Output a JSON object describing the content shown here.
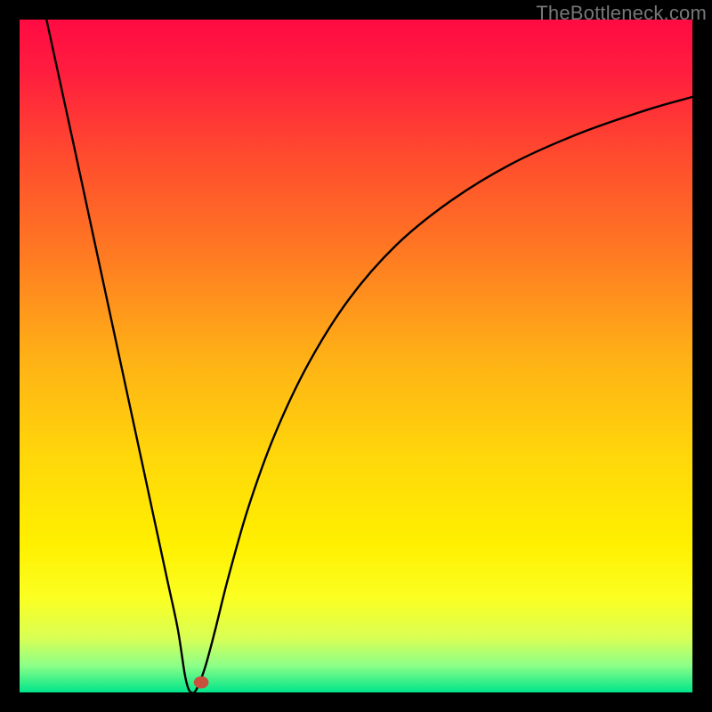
{
  "watermark": "TheBottleneck.com",
  "chart_data": {
    "type": "line",
    "title": "",
    "xlabel": "",
    "ylabel": "",
    "xlim": [
      0,
      100
    ],
    "ylim": [
      0,
      100
    ],
    "grid": false,
    "legend": false,
    "annotations": [],
    "gradient_stops": [
      {
        "offset": 0.0,
        "color": "#ff0b42"
      },
      {
        "offset": 0.08,
        "color": "#ff1e3e"
      },
      {
        "offset": 0.2,
        "color": "#ff4a2e"
      },
      {
        "offset": 0.35,
        "color": "#ff7a22"
      },
      {
        "offset": 0.5,
        "color": "#ffb016"
      },
      {
        "offset": 0.65,
        "color": "#ffd70a"
      },
      {
        "offset": 0.78,
        "color": "#fff000"
      },
      {
        "offset": 0.86,
        "color": "#fbff22"
      },
      {
        "offset": 0.92,
        "color": "#d8ff55"
      },
      {
        "offset": 0.96,
        "color": "#8cff88"
      },
      {
        "offset": 1.0,
        "color": "#00e58a"
      }
    ],
    "curve": {
      "minimum_x": 25.5,
      "minimum_y": 0,
      "points": [
        {
          "x": 4.0,
          "y": 100.0
        },
        {
          "x": 6.0,
          "y": 90.8
        },
        {
          "x": 8.0,
          "y": 81.6
        },
        {
          "x": 10.0,
          "y": 72.3
        },
        {
          "x": 12.0,
          "y": 63.0
        },
        {
          "x": 14.0,
          "y": 53.7
        },
        {
          "x": 16.0,
          "y": 44.4
        },
        {
          "x": 18.0,
          "y": 35.1
        },
        {
          "x": 20.0,
          "y": 25.8
        },
        {
          "x": 22.0,
          "y": 16.5
        },
        {
          "x": 23.5,
          "y": 9.5
        },
        {
          "x": 24.5,
          "y": 3.0
        },
        {
          "x": 25.0,
          "y": 0.8
        },
        {
          "x": 25.5,
          "y": 0.0
        },
        {
          "x": 26.2,
          "y": 0.3
        },
        {
          "x": 27.5,
          "y": 3.5
        },
        {
          "x": 29.0,
          "y": 9.0
        },
        {
          "x": 31.0,
          "y": 17.0
        },
        {
          "x": 34.0,
          "y": 27.5
        },
        {
          "x": 38.0,
          "y": 38.5
        },
        {
          "x": 43.0,
          "y": 49.0
        },
        {
          "x": 49.0,
          "y": 58.5
        },
        {
          "x": 56.0,
          "y": 66.5
        },
        {
          "x": 64.0,
          "y": 73.0
        },
        {
          "x": 73.0,
          "y": 78.5
        },
        {
          "x": 83.0,
          "y": 83.0
        },
        {
          "x": 93.0,
          "y": 86.5
        },
        {
          "x": 100.0,
          "y": 88.5
        }
      ]
    },
    "marker": {
      "x": 27.0,
      "y": 1.5,
      "rx": 1.1,
      "ry": 0.9,
      "color": "#c94f3e"
    }
  }
}
